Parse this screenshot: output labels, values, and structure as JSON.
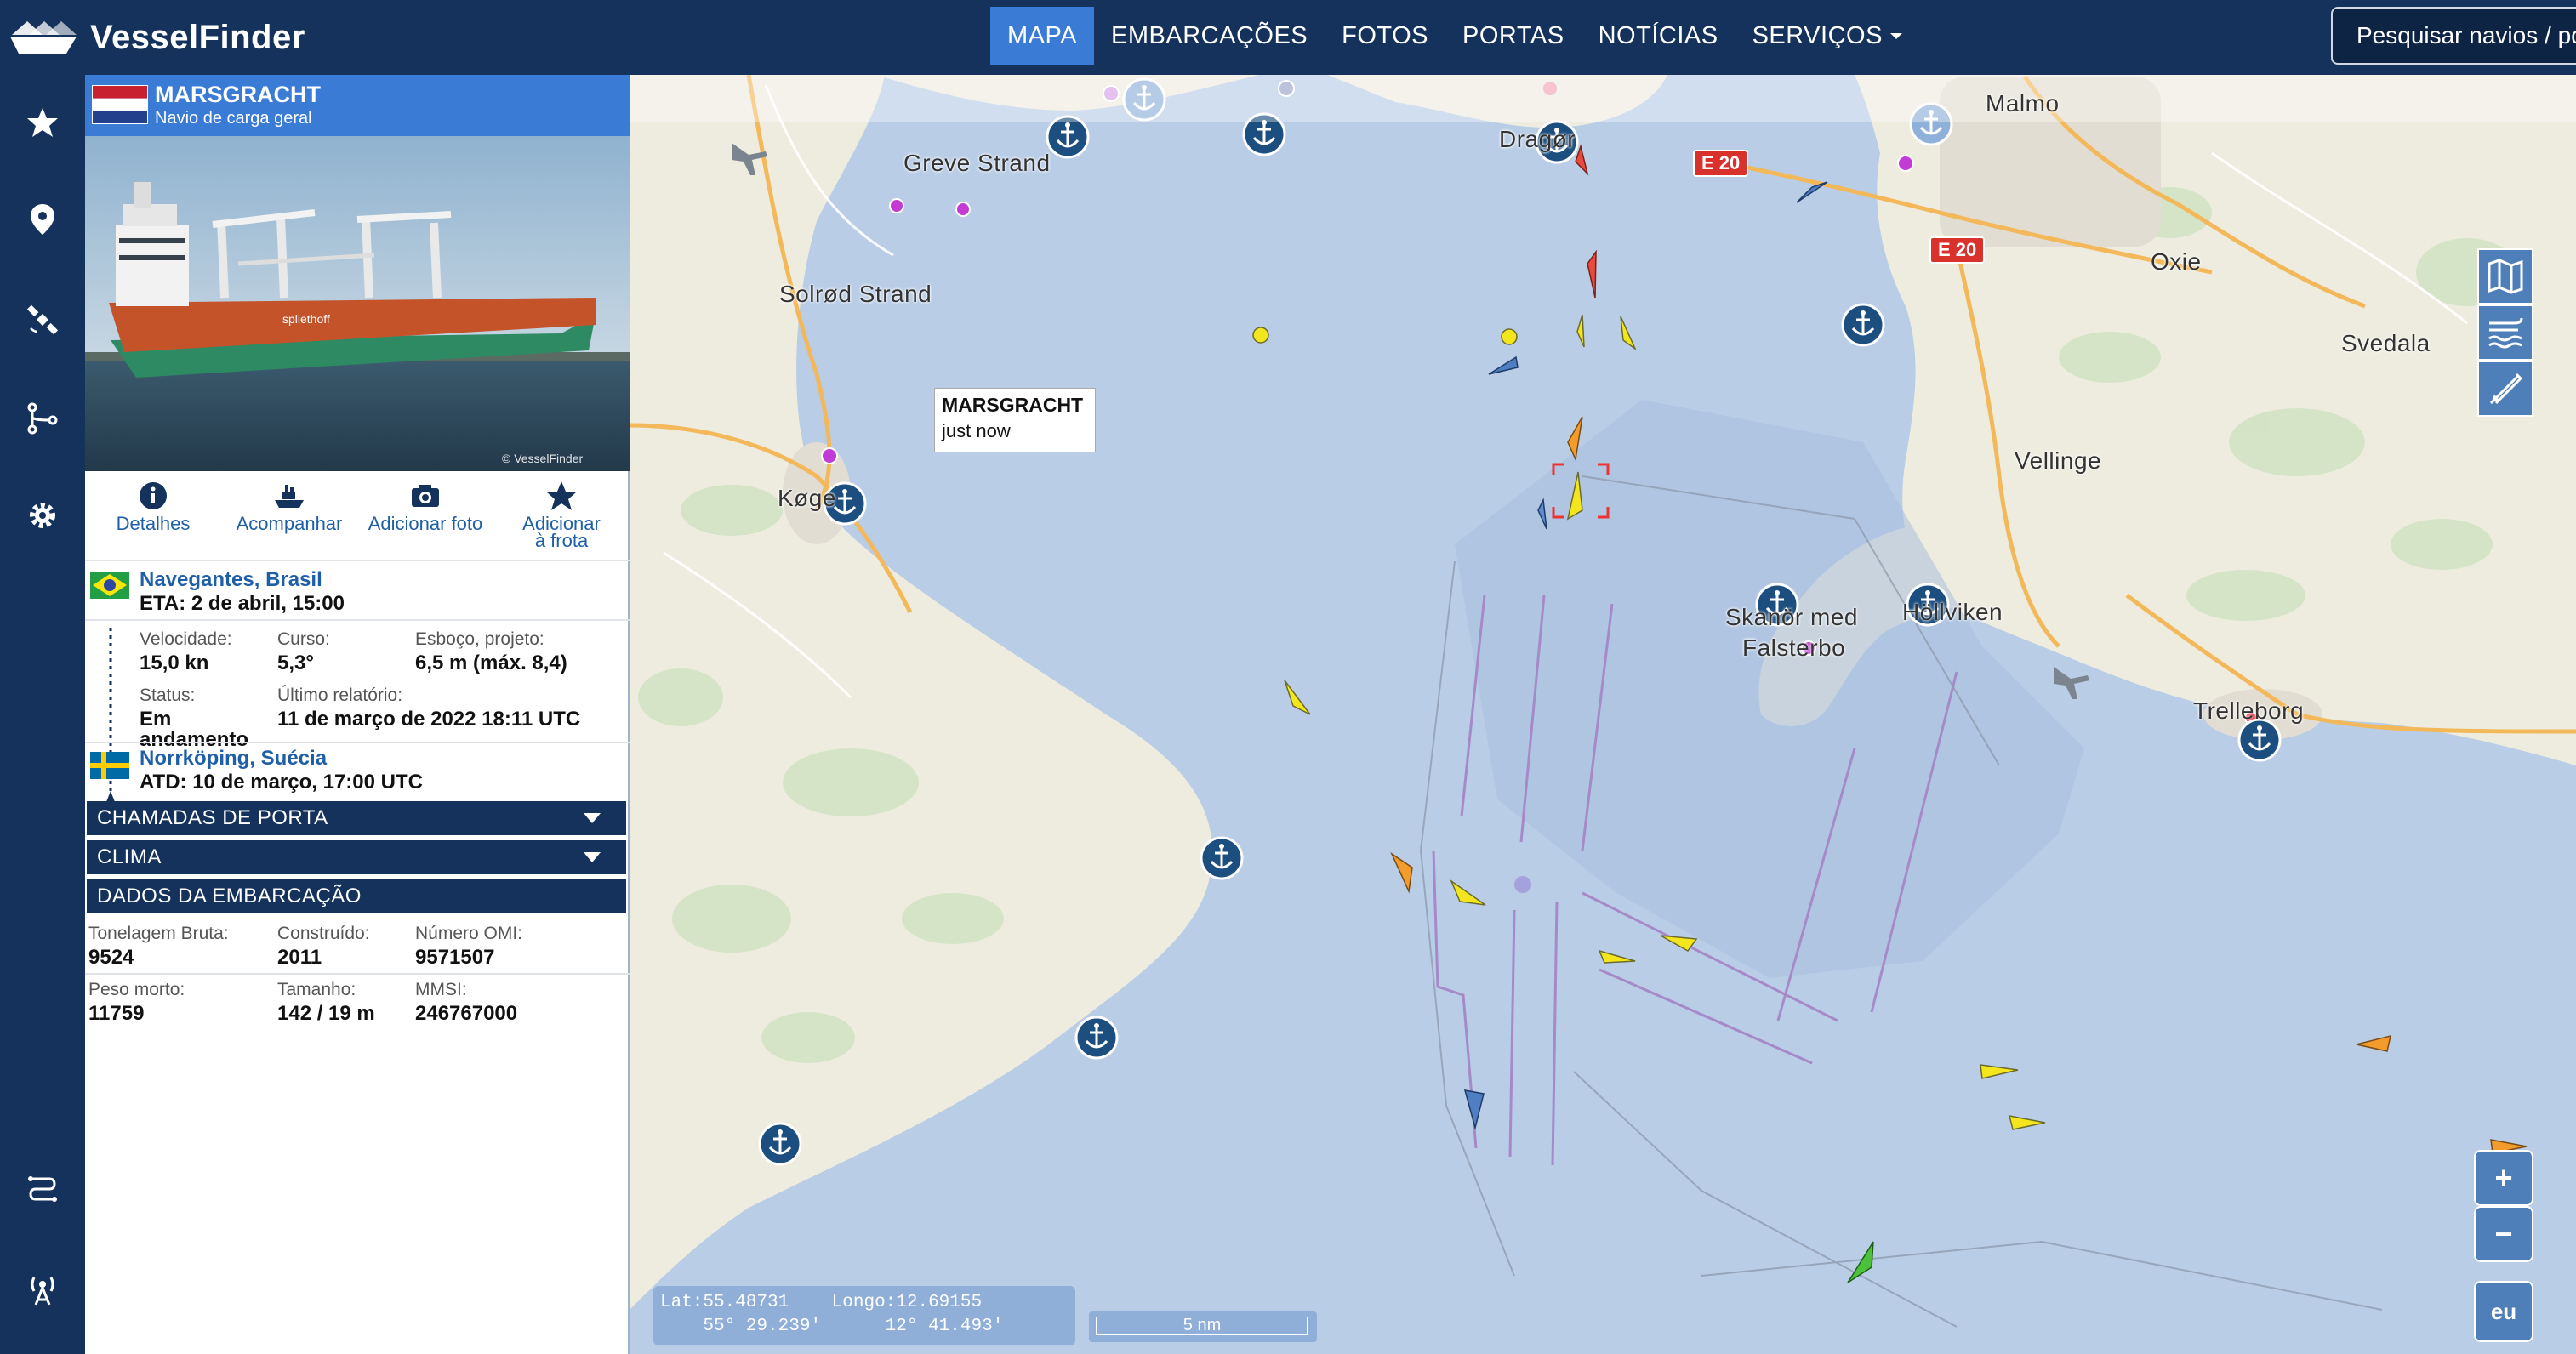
{
  "brand": {
    "name": "VesselFinder"
  },
  "nav": {
    "items": [
      {
        "label": "MAPA"
      },
      {
        "label": "EMBARCAÇÕES"
      },
      {
        "label": "FOTOS"
      },
      {
        "label": "PORTAS"
      },
      {
        "label": "NOTÍCIAS"
      },
      {
        "label": "SERVIÇOS"
      }
    ]
  },
  "search": {
    "placeholder": "Pesquisar navios / portos"
  },
  "vessel": {
    "name": "MARSGRACHT",
    "type": "Navio de carga geral",
    "photo_watermark": "© VesselFinder",
    "hull_text": "spliethoff",
    "actions": [
      {
        "label": "Detalhes",
        "icon": "info-icon"
      },
      {
        "label": "Acompanhar",
        "icon": "ship-icon"
      },
      {
        "label": "Adicionar foto",
        "icon": "camera-icon"
      },
      {
        "label": "Adicionar à frota",
        "icon": "star-icon"
      }
    ],
    "destination": {
      "place": "Navegantes, Brasil",
      "eta": "ETA: 2 de abril, 15:00"
    },
    "speed": {
      "label": "Velocidade:",
      "value": "15,0 kn"
    },
    "course": {
      "label": "Curso:",
      "value": "5,3°"
    },
    "draught": {
      "label": "Esboço, projeto:",
      "value": "6,5 m (máx. 8,4)"
    },
    "status": {
      "label": "Status:",
      "value_line1": "Em",
      "value_line2": "andamento"
    },
    "last_report": {
      "label": "Último relatório:",
      "value": "11 de março de 2022 18:11 UTC"
    },
    "departure": {
      "place": "Norrköping, Suécia",
      "atd": "ATD: 10 de março, 17:00 UTC"
    },
    "sections": {
      "port_calls": "CHAMADAS DE PORTA",
      "weather": "CLIMA",
      "vessel_data": "DADOS DA EMBARCAÇÃO"
    },
    "gross_tonnage": {
      "label": "Tonelagem Bruta:",
      "value": "9524"
    },
    "built": {
      "label": "Construído:",
      "value": "2011"
    },
    "imo": {
      "label": "Número OMI:",
      "value": "9571507"
    },
    "deadweight": {
      "label": "Peso morto:",
      "value": "11759"
    },
    "size": {
      "label": "Tamanho:",
      "value": "142 / 19 m"
    },
    "mmsi": {
      "label": "MMSI:",
      "value": "246767000"
    }
  },
  "map": {
    "labels": {
      "greve": "Greve Strand",
      "solrod": "Solrød Strand",
      "koge": "Køge",
      "dragor": "Dragør",
      "malmo": "Malmo",
      "oxie": "Oxie",
      "svedala": "Svedala",
      "vellinge": "Vellinge",
      "skanor": "Skanör med",
      "falsterbo": "Falsterbo",
      "hollviken": "Höllviken",
      "trelleborg": "Trelleborg"
    },
    "road_badges": {
      "a": "E 20",
      "b": "E 20"
    },
    "popup": {
      "name": "MARSGRACHT",
      "time": "just now"
    },
    "coords": {
      "lat": "Lat:55.48731",
      "lon": "Longo:12.69155",
      "lat_dms": "55° 29.239′",
      "lon_dms": "12° 41.493′"
    },
    "scale": "5 nm",
    "zoom_in": "+",
    "zoom_out": "−",
    "region_button": "eu"
  },
  "colors": {
    "header": "#14325b",
    "accent": "#3a7bd5",
    "sea": "#b9cde6",
    "land": "#eeecdf",
    "anchor": "#1c4f7f"
  }
}
